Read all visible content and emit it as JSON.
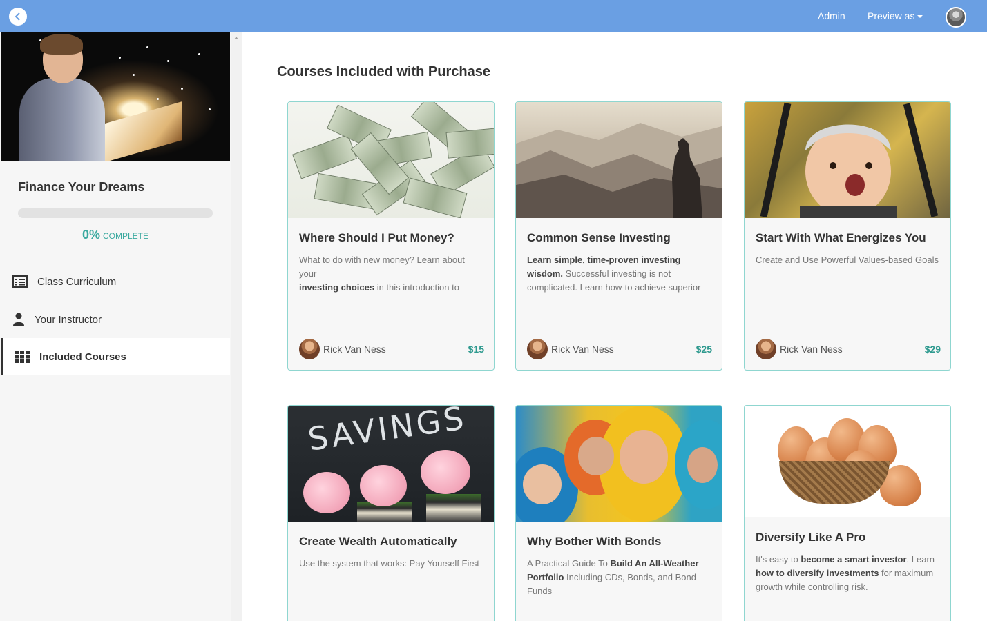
{
  "topbar": {
    "admin_label": "Admin",
    "preview_label": "Preview as"
  },
  "sidebar": {
    "course_title": "Finance Your Dreams",
    "progress_percent": 0,
    "progress_text": "0%",
    "progress_word": "COMPLETE",
    "items": [
      {
        "label": "Class Curriculum",
        "icon": "list-icon"
      },
      {
        "label": "Your Instructor",
        "icon": "user-icon"
      },
      {
        "label": "Included Courses",
        "icon": "grid-icon",
        "active": true
      }
    ]
  },
  "main": {
    "heading": "Courses Included with Purchase",
    "cards": [
      {
        "title": "Where Should I Put Money?",
        "desc_plain_1": "What to do with new money? Learn about your",
        "desc_bold_1": "investing choices",
        "desc_plain_2": " in this introduction to",
        "author": "Rick Van Ness",
        "price": "$15"
      },
      {
        "title": "Common Sense Investing",
        "desc_bold_1": "Learn simple, time-proven investing wisdom.",
        "desc_plain_1": " Successful investing is not complicated. Learn how-to achieve superior",
        "author": "Rick Van Ness",
        "price": "$25"
      },
      {
        "title": "Start With What Energizes You",
        "desc_plain_1": "Create and Use Powerful Values-based Goals",
        "author": "Rick Van Ness",
        "price": "$29"
      },
      {
        "title": "Create Wealth Automatically",
        "desc_plain_1": "Use the system that works: Pay Yourself First",
        "image_text": "SAVINGS"
      },
      {
        "title": "Why Bother With Bonds",
        "desc_plain_1": "A Practical Guide To ",
        "desc_bold_1": "Build An All-Weather Portfolio",
        "desc_plain_2": " Including CDs, Bonds, and Bond Funds"
      },
      {
        "title": "Diversify Like A Pro",
        "desc_plain_1": "It's easy to ",
        "desc_bold_1": "become a smart investor",
        "desc_plain_2": ". Learn ",
        "desc_bold_2": "how to diversify investments",
        "desc_plain_3": " for maximum growth while controlling risk."
      }
    ]
  },
  "colors": {
    "topbar": "#6a9fe3",
    "accent": "#3aa99f",
    "card_border": "#8fd6d0"
  }
}
